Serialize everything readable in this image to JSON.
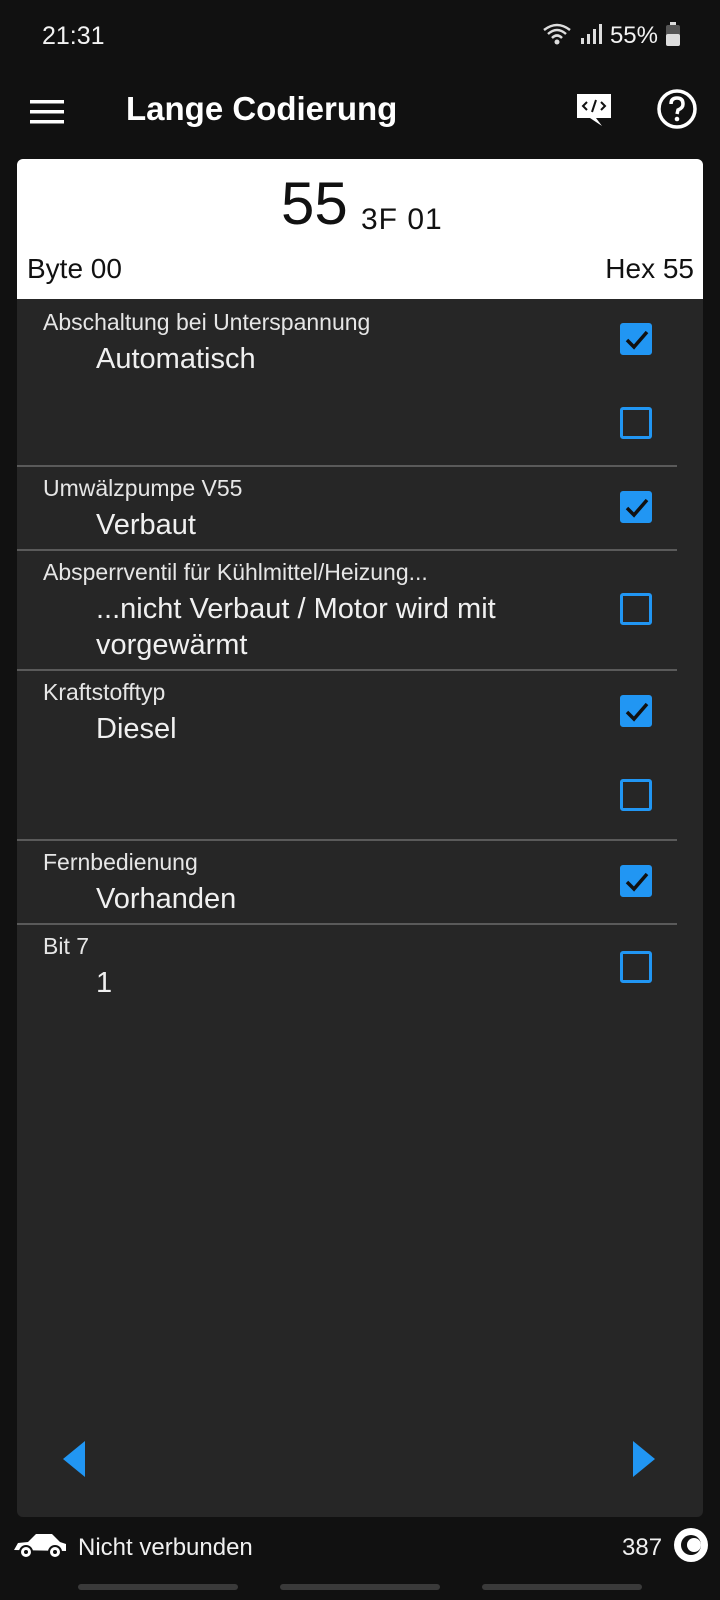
{
  "status": {
    "time": "21:31",
    "battery": "55%"
  },
  "appbar": {
    "title": "Lange Codierung",
    "icons": [
      "menu-icon",
      "code-icon",
      "help-icon"
    ]
  },
  "header": {
    "main_value": "55",
    "rest_values": "3F 01",
    "byte_label": "Byte 00",
    "hex_label": "Hex 55"
  },
  "bits": [
    {
      "title": "Abschaltung bei Unterspannung",
      "value": "Automatisch",
      "checkboxes": [
        true,
        false
      ]
    },
    {
      "title": "Umwälzpumpe V55",
      "value": "Verbaut",
      "checkboxes": [
        true
      ]
    },
    {
      "title": "Absperrventil für Kühlmittel/Heizung...",
      "value": "...nicht Verbaut / Motor wird mit vorgewärmt",
      "checkboxes": [
        false
      ]
    },
    {
      "title": "Kraftstofftyp",
      "value": "Diesel",
      "checkboxes": [
        true,
        false
      ]
    },
    {
      "title": "Fernbedienung",
      "value": "Vorhanden",
      "checkboxes": [
        true
      ]
    },
    {
      "title": "Bit 7",
      "value": "1",
      "checkboxes": [
        false
      ]
    }
  ],
  "footer": {
    "connection": "Nicht verbunden",
    "counter": "387"
  },
  "colors": {
    "accent": "#2196f3",
    "card": "#262626",
    "background": "#111111"
  }
}
